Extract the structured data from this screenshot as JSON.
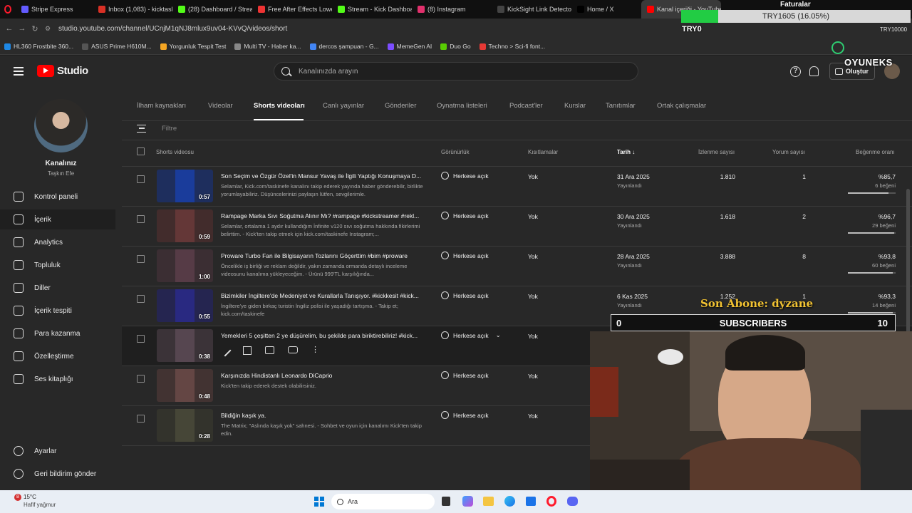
{
  "browser_tabs": [
    {
      "label": "Stripe Express",
      "color": "#635bff"
    },
    {
      "label": "Inbox (1,083) - kicktaskine",
      "color": "#d93025"
    },
    {
      "label": "(28) Dashboard / Streamla",
      "color": "#53fc18"
    },
    {
      "label": "Free After Effects Lower T",
      "color": "#e33"
    },
    {
      "label": "Stream - Kick Dashboard",
      "color": "#53fc18"
    },
    {
      "label": "(8) Instagram",
      "color": "#e1306c"
    },
    {
      "label": "KickSight Link Detector",
      "color": "#444"
    },
    {
      "label": "Home / X",
      "color": "#000"
    },
    {
      "label": "Kanal içeriği - YouTube S",
      "color": "#ff0000"
    }
  ],
  "address_url": "studio.youtube.com/channel/UCnjM1qNJ8mlux9uv04-KVvQ/videos/short",
  "bookmarks": [
    {
      "label": "HL360 Frostbite 360...",
      "color": "#1e88e5"
    },
    {
      "label": "ASUS Prime H610M...",
      "color": "#555"
    },
    {
      "label": "Yorgunluk Tespit Test",
      "color": "#f5a623"
    },
    {
      "label": "Multi TV - Haber ka...",
      "color": "#888"
    },
    {
      "label": "dercos şampuan - G...",
      "color": "#4285f4"
    },
    {
      "label": "MemeGen AI",
      "color": "#7c4dff"
    },
    {
      "label": "Duo Go",
      "color": "#58cc02"
    },
    {
      "label": "Techno > Sci-fi font...",
      "color": "#e53935"
    }
  ],
  "header": {
    "logo_text": "Studio",
    "search_placeholder": "Kanalınızda arayın",
    "create_label": "Oluştur"
  },
  "channel": {
    "title": "Kanalınız",
    "name": "Taşkın Efe"
  },
  "sidebar": {
    "items": [
      {
        "label": "Kontrol paneli",
        "icon": "dashboard-icon"
      },
      {
        "label": "İçerik",
        "icon": "content-icon"
      },
      {
        "label": "Analytics",
        "icon": "analytics-icon"
      },
      {
        "label": "Topluluk",
        "icon": "community-icon"
      },
      {
        "label": "Diller",
        "icon": "subtitles-icon"
      },
      {
        "label": "İçerik tespiti",
        "icon": "copyright-icon"
      },
      {
        "label": "Para kazanma",
        "icon": "dollar-icon"
      },
      {
        "label": "Özelleştirme",
        "icon": "magic-wand-icon"
      },
      {
        "label": "Ses kitaplığı",
        "icon": "audio-library-icon"
      }
    ],
    "bottom": [
      {
        "label": "Ayarlar",
        "icon": "gear-icon"
      },
      {
        "label": "Geri bildirim gönder",
        "icon": "feedback-icon"
      }
    ]
  },
  "content_tabs": [
    "İlham kaynakları",
    "Videolar",
    "Shorts videoları",
    "Canlı yayınlar",
    "Gönderiler",
    "Oynatma listeleri",
    "Podcast'ler",
    "Kurslar",
    "Tanıtımlar",
    "Ortak çalışmalar"
  ],
  "filter_placeholder": "Filtre",
  "columns": {
    "video": "Shorts videosu",
    "visibility": "Görünürlük",
    "restrictions": "Kısıtlamalar",
    "date": "Tarih",
    "views": "İzlenme sayısı",
    "comments": "Yorum sayısı",
    "likes": "Beğenme oranı"
  },
  "rows": [
    {
      "title": "Son Seçim ve Özgür Özel'in Mansur Yavaş ile İlgili Yaptığı Konuşmaya D...",
      "desc": "Selamlar, Kick.com/taskinefe kanalını takip ederek yayında haber gönderebilir, birlikte yorumlayabiliriz. Düşüncelerinizi paylaşın lütfen, sevgilerimle.",
      "duration": "0:57",
      "visibility": "Herkese açık",
      "restrictions": "Yok",
      "date": "31 Ara 2025",
      "status": "Yayınlandı",
      "views": "1.810",
      "comments": "1",
      "like_pct": "%85,7",
      "like_count": "6 beğeni",
      "like_frac": 0.857,
      "thumb": "#1a3fa6"
    },
    {
      "title": "Rampage Marka Sıvı Soğutma Alınır Mı? #rampage #kickstreamer #rekl...",
      "desc": "Selamlar, ortalama 1 aydır kullandığım İnfinite v120 sıvı soğutma hakkında fikirlerimi belirttim. - Kick'ten takip etmek için kick.com/taskinefe Instagram;...",
      "duration": "0:59",
      "visibility": "Herkese açık",
      "restrictions": "Yok",
      "date": "30 Ara 2025",
      "status": "Yayınlandı",
      "views": "1.618",
      "comments": "2",
      "like_pct": "%96,7",
      "like_count": "29 beğeni",
      "like_frac": 0.967,
      "thumb": "#6b3a3a"
    },
    {
      "title": "Proware Turbo Fan ile Bilgisayarın Tozlarını Göçerttim #bim #proware",
      "desc": "Öncelikle iş birliği ve reklam değildir, yakın zamanda ormanda detaylı inceleme videosunu kanalıma yükleyeceğim. - Ürünü 999'TL karşılığında...",
      "duration": "1:00",
      "visibility": "Herkese açık",
      "restrictions": "Yok",
      "date": "28 Ara 2025",
      "status": "Yayınlandı",
      "views": "3.888",
      "comments": "8",
      "like_pct": "%93,8",
      "like_count": "60 beğeni",
      "like_frac": 0.938,
      "thumb": "#5a3e4a"
    },
    {
      "title": "Bizimkiler İngiltere'de Medeniyet ve Kurallarla Tanışıyor. #kickkesit #kick...",
      "desc": "İngiltere'ye giden birkaç turistin İngiliz polisi ile yaşadığı tartışma. - Takip et; kick.com/taskinefe",
      "duration": "0:55",
      "visibility": "Herkese açık",
      "restrictions": "Yok",
      "date": "6 Kas 2025",
      "status": "Yayınlandı",
      "views": "1.252",
      "comments": "1",
      "like_pct": "%93,3",
      "like_count": "14 beğeni",
      "like_frac": 0.933,
      "thumb": "#2a2a8a"
    },
    {
      "title": "Yemekleri 5 çeşitten 2 ye düşürelim, bu şekilde para biriktirebiliriz! #kick...",
      "desc": "",
      "duration": "0:38",
      "visibility": "Herkese açık",
      "restrictions": "Yok",
      "date": "",
      "status": "",
      "views": "",
      "comments": "",
      "like_pct": "",
      "like_count": "",
      "like_frac": 0,
      "thumb": "#5a4a55",
      "hover": true
    },
    {
      "title": "Karşınızda Hindistanlı Leonardo DiCaprio",
      "desc": "Kick'ten takip ederek destek olabilirsiniz.",
      "duration": "0:48",
      "visibility": "Herkese açık",
      "restrictions": "Yok",
      "date": "",
      "status": "",
      "views": "",
      "comments": "",
      "like_pct": "",
      "like_count": "",
      "like_frac": 0,
      "thumb": "#6a4a48"
    },
    {
      "title": "Bildiğin kaşık ya.",
      "desc": "The Matrix; \"Aslında kaşık yok\" sahnesi. - Sohbet ve oyun için kanalımı Kick'ten takip edin.",
      "duration": "0:28",
      "visibility": "Herkese açık",
      "restrictions": "Yok",
      "date": "",
      "status": "",
      "views": "",
      "comments": "",
      "like_pct": "",
      "like_count": "",
      "like_frac": 0,
      "thumb": "#4a4a3a"
    }
  ],
  "overlay": {
    "goal_title": "Faturalar",
    "goal_text": "TRY1605 (16.05%)",
    "goal_min": "TRY0",
    "goal_max": "TRY10000",
    "brand": "OYUNEKS",
    "last_sub_label": "Son Abone: dyzane",
    "sub_left": "0",
    "sub_title": "SUBSCRIBERS",
    "sub_right": "10"
  },
  "taskbar": {
    "temp": "15°C",
    "weather": "Hafif yağmur",
    "weather_badge": "8",
    "search": "Ara"
  }
}
